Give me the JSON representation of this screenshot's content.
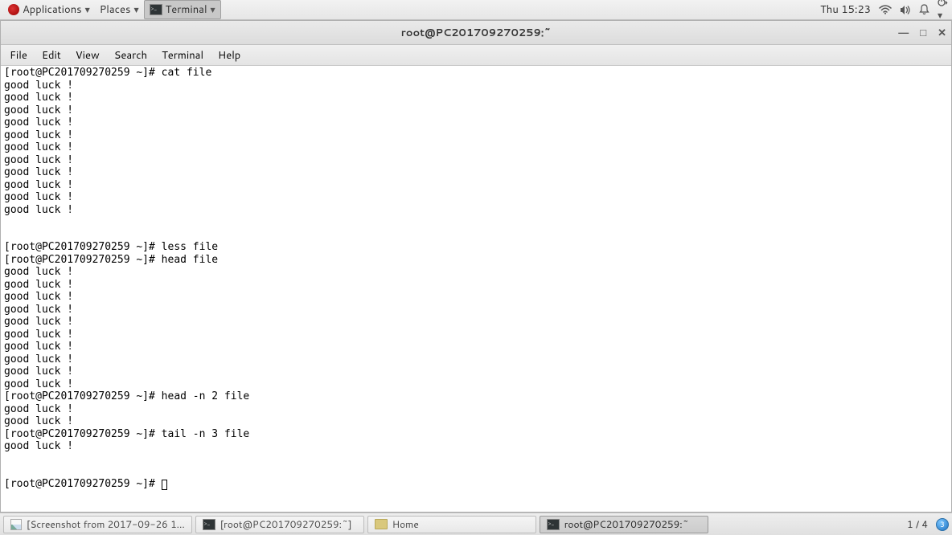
{
  "top_panel": {
    "applications": "Applications",
    "places": "Places",
    "terminal": "Terminal",
    "clock": "Thu 15:23"
  },
  "window": {
    "title": "root@PC201709270259:~",
    "menubar": [
      "File",
      "Edit",
      "View",
      "Search",
      "Terminal",
      "Help"
    ]
  },
  "terminal": {
    "lines": [
      "[root@PC201709270259 ~]# cat file",
      "good luck !",
      "good luck !",
      "good luck !",
      "good luck !",
      "good luck !",
      "good luck !",
      "good luck !",
      "good luck !",
      "good luck !",
      "good luck !",
      "good luck !",
      "",
      "",
      "[root@PC201709270259 ~]# less file",
      "[root@PC201709270259 ~]# head file",
      "good luck !",
      "good luck !",
      "good luck !",
      "good luck !",
      "good luck !",
      "good luck !",
      "good luck !",
      "good luck !",
      "good luck !",
      "good luck !",
      "[root@PC201709270259 ~]# head -n 2 file",
      "good luck !",
      "good luck !",
      "[root@PC201709270259 ~]# tail -n 3 file",
      "good luck !",
      "",
      "",
      "[root@PC201709270259 ~]# "
    ]
  },
  "taskbar": {
    "items": [
      "[Screenshot from 2017-09-26 1...",
      "[root@PC201709270259:~]",
      "Home",
      "root@PC201709270259:~"
    ],
    "pager": "1 / 4",
    "tray": "3"
  }
}
